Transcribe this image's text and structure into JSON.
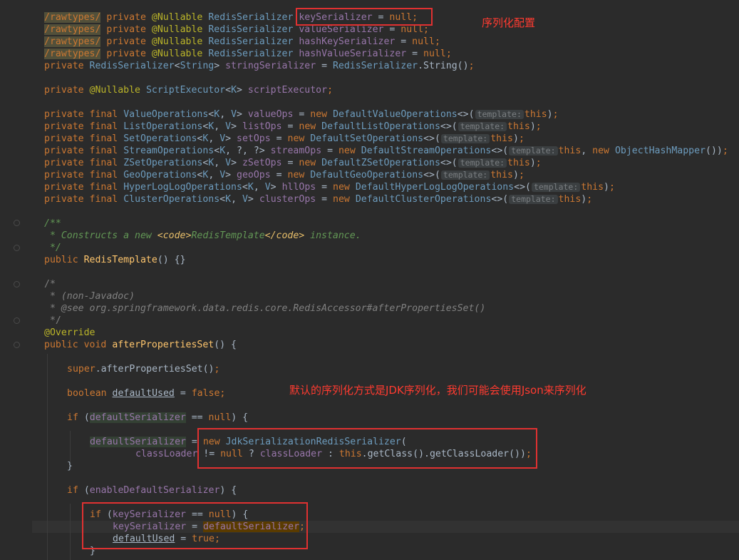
{
  "annotations": {
    "serializer_config": "序列化配置",
    "default_jdk": "默认的序列化方式是JDK序列化，我们可能会使用Json来序列化"
  },
  "code": {
    "rawtypes": "/rawtypes/",
    "private": "private",
    "final": "final",
    "nullable": "@Nullable",
    "redis_serializer": "RedisSerializer",
    "key_serializer": "keySerializer",
    "value_serializer": "valueSerializer",
    "hash_key_serializer": "hashKeySerializer",
    "hash_value_serializer": "hashValueSerializer",
    "string_serializer": "stringSerializer",
    "string": "String",
    "null": "null",
    "script_executor_type": "ScriptExecutor",
    "script_executor": "scriptExecutor",
    "new": "new",
    "this": "this",
    "template_hint": "template:",
    "value_ops_type": "ValueOperations",
    "value_ops": "valueOps",
    "default_value_ops": "DefaultValueOperations",
    "list_ops_type": "ListOperations",
    "list_ops": "listOps",
    "default_list_ops": "DefaultListOperations",
    "set_ops_type": "SetOperations",
    "set_ops": "setOps",
    "default_set_ops": "DefaultSetOperations",
    "stream_ops_type": "StreamOperations",
    "stream_ops": "streamOps",
    "default_stream_ops": "DefaultStreamOperations",
    "object_hash_mapper": "ObjectHashMapper",
    "zset_ops_type": "ZSetOperations",
    "zset_ops": "zSetOps",
    "default_zset_ops": "DefaultZSetOperations",
    "geo_ops_type": "GeoOperations",
    "geo_ops": "geoOps",
    "default_geo_ops": "DefaultGeoOperations",
    "hll_ops_type": "HyperLogLogOperations",
    "hll_ops": "hllOps",
    "default_hll_ops": "DefaultHyperLogLogOperations",
    "cluster_ops_type": "ClusterOperations",
    "cluster_ops": "clusterOps",
    "default_cluster_ops": "DefaultClusterOperations",
    "doc_open": "/**",
    "doc_constructs": " * Constructs a new ",
    "code_open": "<code>",
    "redis_template": "RedisTemplate",
    "code_close": "</code>",
    "doc_instance": " instance.",
    "doc_close": " */",
    "public": "public",
    "ctor_tail": "() {}",
    "comment_open": "/*",
    "non_javadoc": " * (non-Javadoc)",
    "see_tag": " * @see",
    "see_ref": " org.springframework.data.redis.core.RedisAccessor#afterPropertiesSet()",
    "comment_close": " */",
    "override": "@Override",
    "void": "void",
    "after_properties_set": "afterPropertiesSet",
    "super": "super",
    "boolean": "boolean",
    "default_used": "defaultUsed",
    "false": "false",
    "true": "true",
    "if": "if",
    "default_serializer": "defaultSerializer",
    "jdk_serializer": "JdkSerializationRedisSerializer",
    "class_loader": "classLoader",
    "get_class": "getClass",
    "get_class_loader": "getClassLoader",
    "enable_default_serializer": "enableDefaultSerializer"
  }
}
